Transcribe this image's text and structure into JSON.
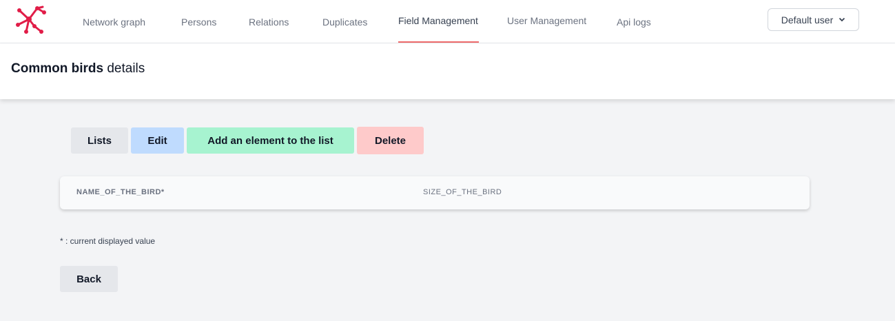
{
  "nav": {
    "items": [
      {
        "label": "Network graph"
      },
      {
        "label": "Persons"
      },
      {
        "label": "Relations"
      },
      {
        "label": "Duplicates"
      },
      {
        "label": "Field Management"
      },
      {
        "label": "User Management"
      },
      {
        "label": "Api logs"
      }
    ],
    "active_index": 4,
    "user_menu": {
      "label": "Default user",
      "icon": "chevron-down-icon"
    }
  },
  "header": {
    "title_bold": "Common birds",
    "title_rest": " details"
  },
  "actions": {
    "lists_label": "Lists",
    "edit_label": "Edit",
    "add_label": "Add an element to the list",
    "delete_label": "Delete"
  },
  "table": {
    "columns": [
      "NAME_OF_THE_BIRD*",
      "SIZE_OF_THE_BIRD"
    ]
  },
  "footnote": "* : current displayed value",
  "back_label": "Back",
  "colors": {
    "accent": "#ef6b6b",
    "edit": "#bfdbfe",
    "add": "#a7f3d0",
    "delete": "#fecaca",
    "neutral": "#e5e7eb"
  }
}
